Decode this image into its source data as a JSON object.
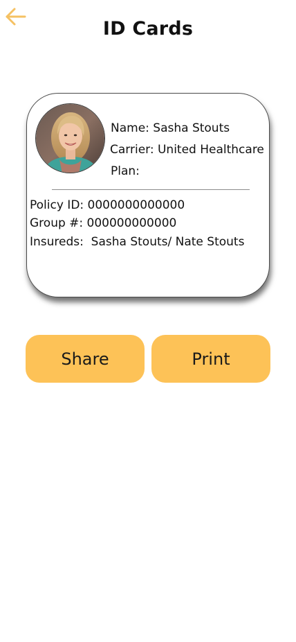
{
  "header": {
    "title": "ID Cards",
    "back_icon": "arrow-left-icon"
  },
  "card": {
    "name": "Name: Sasha Stouts",
    "carrier": "Carrier: United Healthcare",
    "plan": "Plan:",
    "policy_id": "Policy ID: 0000000000000",
    "group_number": "Group #: 000000000000",
    "insureds": "Insureds:  Sasha Stouts/ Nate Stouts"
  },
  "actions": {
    "share_label": "Share",
    "print_label": "Print"
  },
  "colors": {
    "accent": "#fdc257",
    "back_arrow": "#f5c163",
    "divider": "#8c8c8c"
  }
}
